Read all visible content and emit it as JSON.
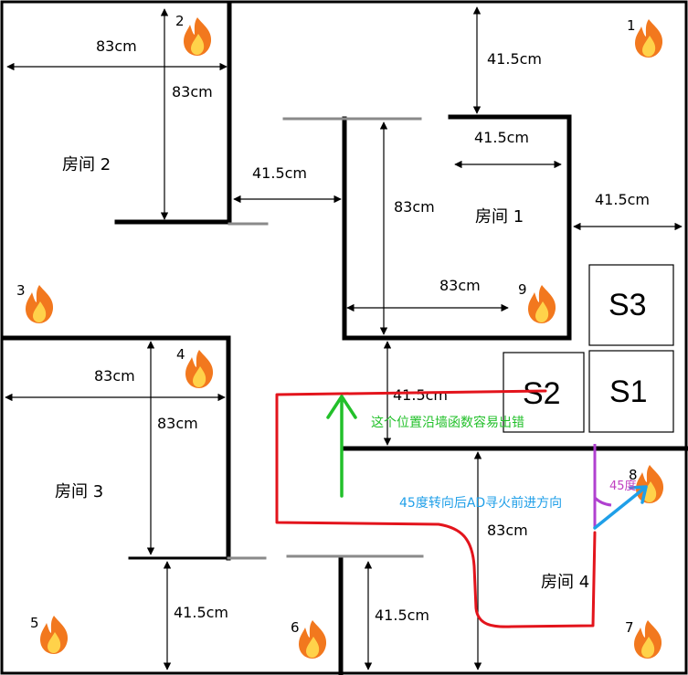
{
  "rooms": {
    "room1": "房间 1",
    "room2": "房间 2",
    "room3": "房间 3",
    "room4": "房间 4"
  },
  "fire_numbers": [
    "1",
    "2",
    "3",
    "4",
    "5",
    "6",
    "7",
    "8",
    "9"
  ],
  "dimensions": {
    "room2_width": "83cm",
    "room2_height": "83cm",
    "top_gap": "41.5cm",
    "room1_door_width": "41.5cm",
    "corridor_left": "41.5cm",
    "right_corridor": "41.5cm",
    "room1_height": "83cm",
    "room1_width": "83cm",
    "middle_gap": "41.5cm",
    "room3_width": "83cm",
    "room3_height": "83cm",
    "room4_height": "83cm",
    "bottom_left_gap": "41.5cm",
    "bottom_mid_gap": "41.5cm"
  },
  "boxes": {
    "s1": "S1",
    "s2": "S2",
    "s3": "S3"
  },
  "annotations": {
    "wall_follow_note": "这个位置沿墙函数容易出错",
    "turn_note": "45度转向后AD寻火前进方向",
    "angle_note": "45度"
  },
  "colors": {
    "path_red": "#e3141c",
    "arrow_green": "#22c02a",
    "arrow_blue": "#1f9fe8",
    "angle_magenta": "#b040d0",
    "flame_outer": "#f2781e",
    "flame_inner": "#ffd24a"
  }
}
